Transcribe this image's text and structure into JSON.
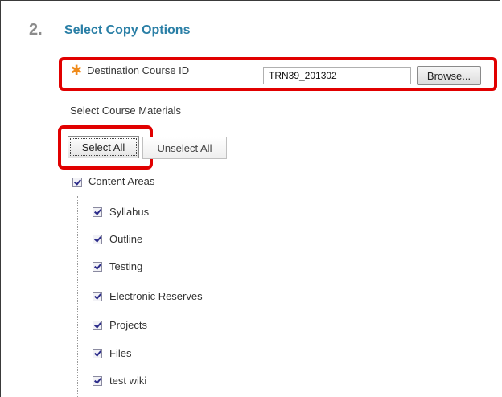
{
  "section": {
    "step_number": "2.",
    "title": "Select Copy Options"
  },
  "destination": {
    "required_marker": "✱",
    "label": "Destination Course ID",
    "value": "TRN39_201302",
    "browse_label": "Browse..."
  },
  "materials": {
    "label": "Select Course Materials",
    "select_all_label": "Select All",
    "unselect_all_label": "Unselect All",
    "parent": {
      "label": "Content Areas",
      "checked": true
    },
    "items": [
      {
        "label": "Syllabus",
        "checked": true
      },
      {
        "label": "Outline",
        "checked": true
      },
      {
        "label": "Testing",
        "checked": true
      },
      {
        "label": "Electronic Reserves",
        "checked": true
      },
      {
        "label": "Projects",
        "checked": true
      },
      {
        "label": "Files",
        "checked": true
      },
      {
        "label": "test wiki",
        "checked": true
      }
    ]
  },
  "colors": {
    "highlight": "#e10000",
    "title": "#2a7fa6",
    "required": "#ef8a1a"
  }
}
